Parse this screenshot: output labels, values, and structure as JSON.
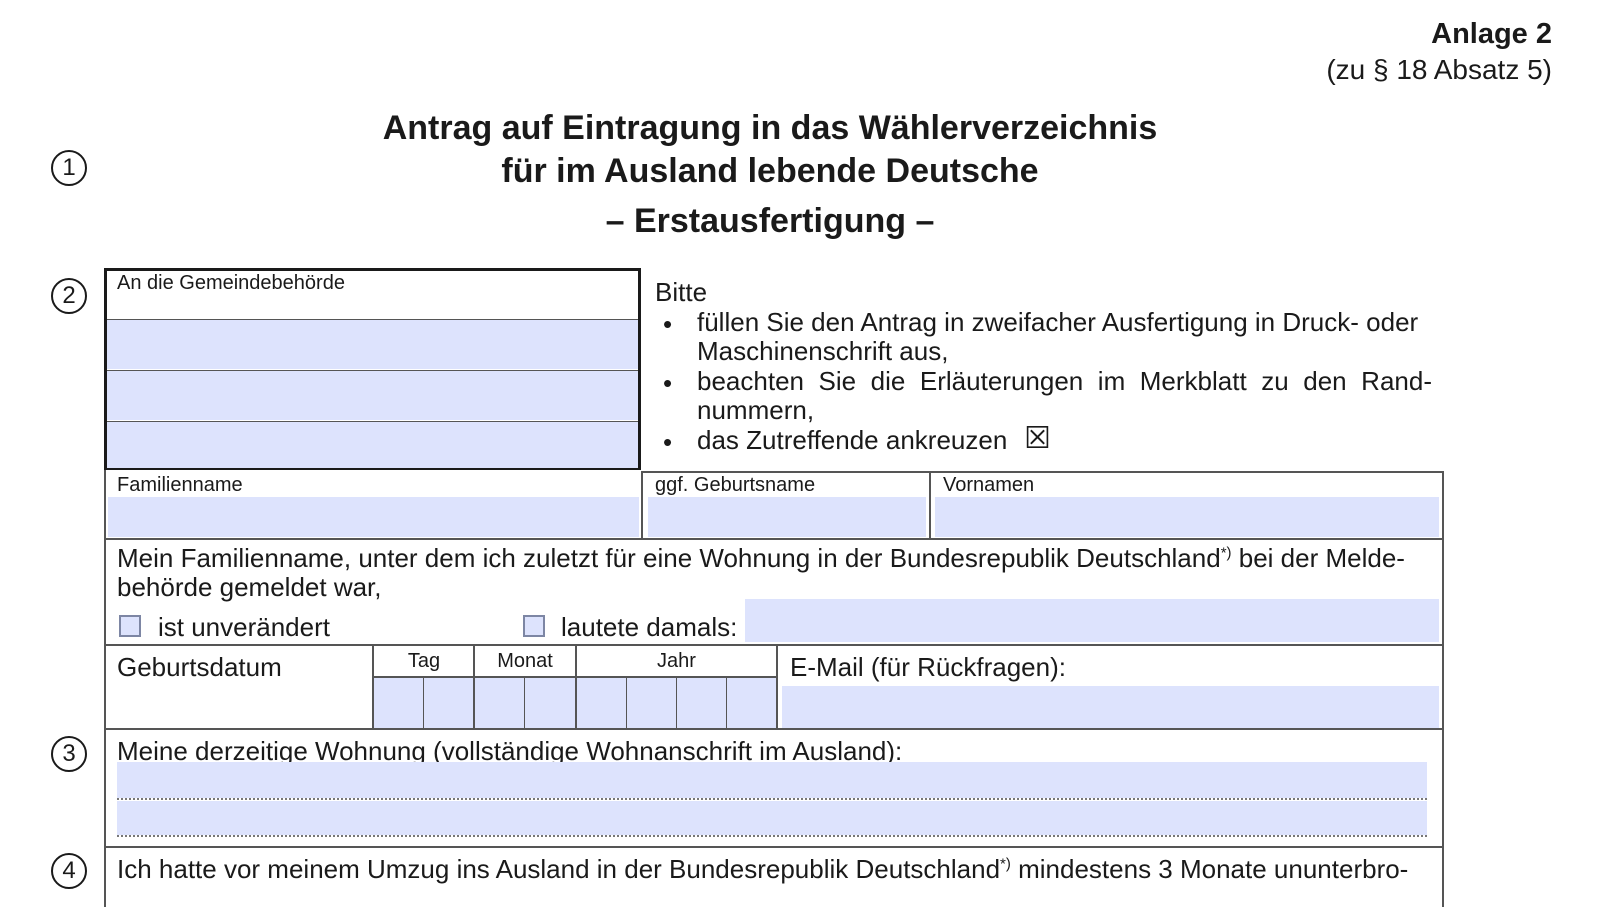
{
  "header": {
    "annex": "Anlage 2",
    "annex_ref": "(zu § 18 Absatz 5)"
  },
  "title": {
    "line1": "Antrag auf Eintragung in das Wählerverzeichnis",
    "line2": "für im Ausland lebende Deutsche",
    "line3": "– Erstausfertigung –"
  },
  "markers": [
    "1",
    "2",
    "3",
    "4"
  ],
  "authority": {
    "label": "An die Gemeindebehörde"
  },
  "instructions": {
    "intro": "Bitte",
    "bullet": "•",
    "item1_line1": "füllen Sie den Antrag in zweifacher Ausfertigung in Druck- oder",
    "item1_line2": "Maschinenschrift aus,",
    "item2_line1": "beachten Sie die Erläuterungen im Merkblatt zu den Rand-",
    "item2_line2": "nummern,",
    "item3": "das Zutreffende ankreuzen",
    "check_symbol": "☒"
  },
  "name_fields": {
    "family_name": "Familienname",
    "birth_name": "ggf. Geburtsname",
    "first_names": "Vornamen"
  },
  "previous_name": {
    "text_line1": "Mein Familienname, unter dem ich zuletzt für eine Wohnung in der Bundesrepublik Deutschland",
    "footnote": "*)",
    "text_line1_end": " bei der Melde-",
    "text_line2": "behörde gemeldet war,",
    "option_unchanged": "ist unverändert",
    "option_was": "lautete damals:"
  },
  "birth": {
    "label": "Geburtsdatum",
    "day": "Tag",
    "month": "Monat",
    "year": "Jahr"
  },
  "email": {
    "label": "E-Mail (für Rückfragen):"
  },
  "residence": {
    "label": "Meine derzeitige Wohnung (vollständige Wohnanschrift im Ausland):"
  },
  "section4": {
    "text_start": "Ich hatte vor meinem Umzug ins Ausland in der Bundesrepublik Deutschland",
    "footnote": "*)",
    "text_end": " mindestens 3 Monate ununterbro-"
  },
  "colors": {
    "field_fill": "#dde3fd",
    "line": "#555555",
    "text": "#1a1a1a"
  }
}
